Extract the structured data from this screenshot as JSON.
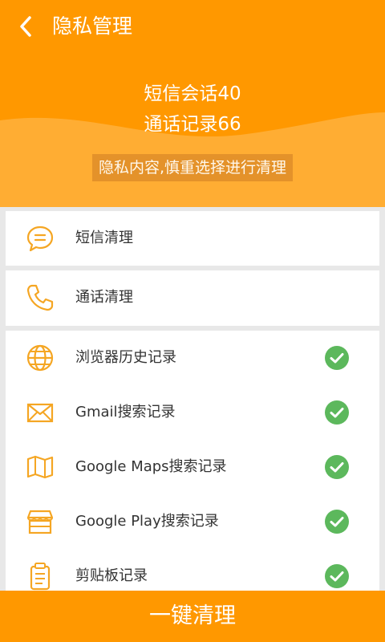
{
  "header": {
    "title": "隐私管理",
    "stats": [
      {
        "label": "短信会话",
        "value": "40"
      },
      {
        "label": "通话记录",
        "value": "66"
      }
    ],
    "notice": "隐私内容,慎重选择进行清理"
  },
  "rows": {
    "sms": {
      "label": "短信清理",
      "icon": "chat-bubble-icon"
    },
    "call": {
      "label": "通话清理",
      "icon": "phone-icon"
    },
    "items": [
      {
        "label": "浏览器历史记录",
        "icon": "globe-icon",
        "checked": true
      },
      {
        "label": "Gmail搜索记录",
        "icon": "mail-icon",
        "checked": true
      },
      {
        "label": "Google Maps搜索记录",
        "icon": "map-icon",
        "checked": true
      },
      {
        "label": "Google Play搜索记录",
        "icon": "store-icon",
        "checked": true
      },
      {
        "label": "剪贴板记录",
        "icon": "clipboard-icon",
        "checked": true
      }
    ]
  },
  "footer": {
    "button_label": "一键清理"
  },
  "colors": {
    "accent": "#ff9800",
    "check": "#5cb85c",
    "icon": "#f5a623"
  }
}
